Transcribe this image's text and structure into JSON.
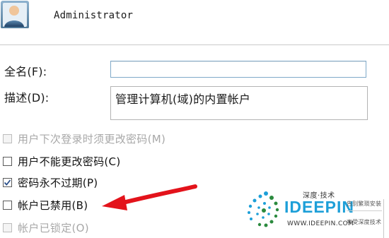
{
  "user": {
    "name": "Administrator",
    "icon": "user-account-icon"
  },
  "form": {
    "full_name_label": "全名(F):",
    "full_name_value": "",
    "description_label": "描述(D):",
    "description_value": "管理计算机(域)的内置帐户"
  },
  "options": [
    {
      "label": "用户下次登录时须更改密码(M)",
      "checked": false,
      "enabled": false
    },
    {
      "label": "用户不能更改密码(C)",
      "checked": false,
      "enabled": true
    },
    {
      "label": "密码永不过期(P)",
      "checked": true,
      "enabled": true
    },
    {
      "label": "帐户已禁用(B)",
      "checked": false,
      "enabled": true
    },
    {
      "label": "帐户已锁定(O)",
      "checked": false,
      "enabled": false
    }
  ],
  "annotation": {
    "arrow_color": "#e3131b"
  },
  "watermark": {
    "title": "深度·技术",
    "name": "IDEEPIN",
    "url": "WWW.IDEEPIN.COM",
    "tagline_1": "告别繁琐安装",
    "tagline_2": "享受深度技术",
    "brand_color": "#1d9fd8"
  }
}
